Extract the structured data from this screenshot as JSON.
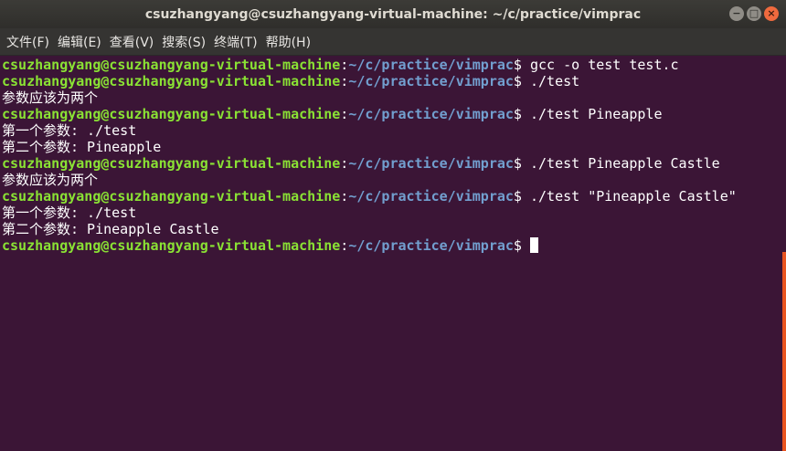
{
  "window": {
    "title": "csuzhangyang@csuzhangyang-virtual-machine: ~/c/practice/vimprac",
    "controls": {
      "minimize": "−",
      "maximize": "□",
      "close": "×"
    }
  },
  "menu": [
    "文件(F)",
    "编辑(E)",
    "查看(V)",
    "搜索(S)",
    "终端(T)",
    "帮助(H)"
  ],
  "terminal": {
    "user_host": "csuzhangyang@csuzhangyang-virtual-machine",
    "path": "~/c/practice/vimprac",
    "lines": [
      {
        "type": "prompt",
        "cmd": "gcc -o test test.c"
      },
      {
        "type": "prompt",
        "cmd": "./test"
      },
      {
        "type": "output",
        "text": "参数应该为两个"
      },
      {
        "type": "prompt",
        "cmd": "./test Pineapple"
      },
      {
        "type": "output",
        "text": "第一个参数: ./test"
      },
      {
        "type": "output",
        "text": "第二个参数: Pineapple"
      },
      {
        "type": "prompt",
        "cmd": "./test Pineapple Castle"
      },
      {
        "type": "output",
        "text": "参数应该为两个"
      },
      {
        "type": "prompt",
        "cmd": "./test \"Pineapple Castle\""
      },
      {
        "type": "output",
        "text": "第一个参数: ./test"
      },
      {
        "type": "output",
        "text": "第二个参数: Pineapple Castle"
      },
      {
        "type": "prompt",
        "cmd": "",
        "cursor": true
      }
    ]
  },
  "colors": {
    "background": "#3b1536",
    "user_host": "#8ae234",
    "path": "#729fcf",
    "scrollbar": "#e95420"
  }
}
